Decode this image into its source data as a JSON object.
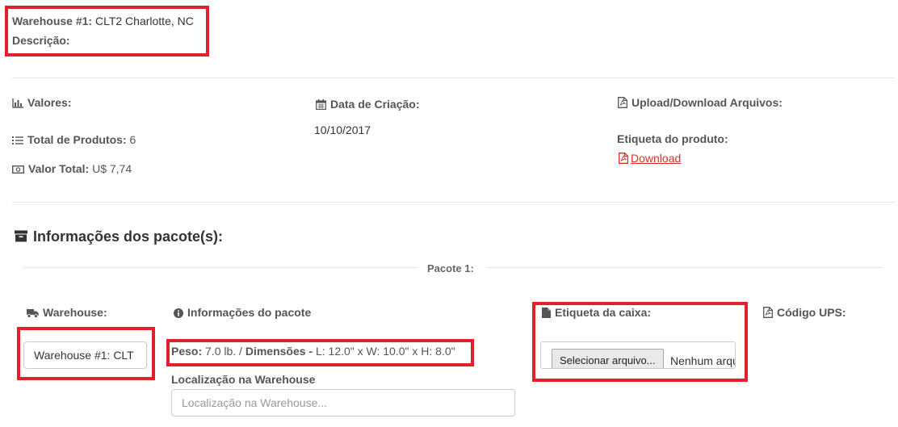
{
  "header": {
    "warehouse_label": "Warehouse #1:",
    "warehouse_value": "CLT2 Charlotte, NC",
    "description_label": "Descrição:"
  },
  "summary": {
    "values_title": "Valores:",
    "total_products_label": "Total de Produtos:",
    "total_products_value": "6",
    "total_value_label": "Valor Total:",
    "total_value_value": "U$ 7,74",
    "creation_date_title": "Data de Criação:",
    "creation_date_value": "10/10/2017",
    "files_title": "Upload/Download Arquivos:",
    "product_label_title": "Etiqueta do produto:",
    "download_link": "Download"
  },
  "packages": {
    "section_title": "Informações dos pacote(s):",
    "package_label": "Pacote 1:",
    "warehouse_col_title": "Warehouse:",
    "warehouse_input_value": "Warehouse #1: CLT",
    "info_col_title": "Informações do pacote",
    "weight_label": "Peso:",
    "weight_value": "7.0 lb. /",
    "dimensions_label": "Dimensões -",
    "dimensions_value": "L: 12.0\" x W: 10.0\" x H: 8.0\"",
    "location_label": "Localização na Warehouse",
    "location_placeholder": "Localização na Warehouse...",
    "box_label_title": "Etiqueta da caixa:",
    "file_button": "Selecionar arquivo...",
    "file_status": "Nenhum arquivo selecionado.",
    "ups_title": "Código UPS:"
  },
  "colors": {
    "highlight": "#e0202c",
    "link": "#d9302c",
    "text": "#555555"
  }
}
